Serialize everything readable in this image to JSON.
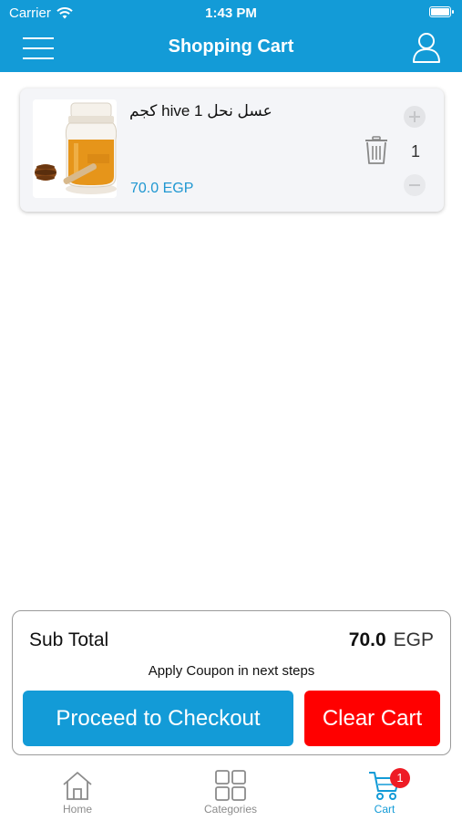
{
  "status_bar": {
    "carrier": "Carrier",
    "time": "1:43 PM"
  },
  "header": {
    "title": "Shopping Cart",
    "menu_icon": "hamburger-menu-icon",
    "profile_icon": "user-profile-icon"
  },
  "cart": {
    "items": [
      {
        "name": "عسل نحل 1 hive كجم",
        "price": "70.0 EGP",
        "quantity": "1",
        "image_icon": "honey-jar-image"
      }
    ]
  },
  "summary": {
    "subtotal_label": "Sub Total",
    "subtotal_amount": "70.0",
    "subtotal_currency": "EGP",
    "coupon_note": "Apply Coupon in next steps",
    "checkout_label": "Proceed to Checkout",
    "clear_label": "Clear Cart"
  },
  "tab_bar": {
    "tabs": [
      {
        "label": "Home",
        "icon": "home-icon",
        "active": false
      },
      {
        "label": "Categories",
        "icon": "grid-icon",
        "active": false
      },
      {
        "label": "Cart",
        "icon": "cart-icon",
        "active": true,
        "badge": "1"
      }
    ]
  },
  "colors": {
    "brand_blue": "#139bd7",
    "clear_red": "#ff0000",
    "badge_red": "#ee1c25",
    "price_blue": "#1f97d1"
  }
}
